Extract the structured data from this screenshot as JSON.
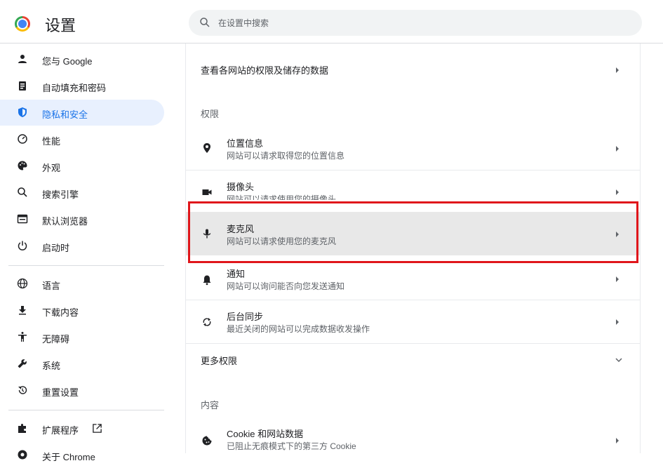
{
  "header": {
    "title": "设置",
    "search_placeholder": "在设置中搜索"
  },
  "sidebar": {
    "items": [
      {
        "label": "您与 Google",
        "icon": "person-icon"
      },
      {
        "label": "自动填充和密码",
        "icon": "clipboard-icon"
      },
      {
        "label": "隐私和安全",
        "icon": "shield-icon",
        "active": true
      },
      {
        "label": "性能",
        "icon": "speedometer-icon"
      },
      {
        "label": "外观",
        "icon": "palette-icon"
      },
      {
        "label": "搜索引擎",
        "icon": "search-icon"
      },
      {
        "label": "默认浏览器",
        "icon": "browser-icon"
      },
      {
        "label": "启动时",
        "icon": "power-icon"
      },
      {
        "label": "语言",
        "icon": "globe-icon"
      },
      {
        "label": "下载内容",
        "icon": "download-icon"
      },
      {
        "label": "无障碍",
        "icon": "accessibility-icon"
      },
      {
        "label": "系统",
        "icon": "wrench-icon"
      },
      {
        "label": "重置设置",
        "icon": "restore-icon"
      },
      {
        "label": "扩展程序",
        "icon": "puzzle-icon"
      },
      {
        "label": "关于 Chrome",
        "icon": "chrome-icon"
      }
    ]
  },
  "content": {
    "view_all_sites": "查看各网站的权限及储存的数据",
    "permissions_header": "权限",
    "permissions": [
      {
        "title": "位置信息",
        "subtitle": "网站可以请求取得您的位置信息",
        "icon": "location-pin-icon"
      },
      {
        "title": "摄像头",
        "subtitle": "网站可以请求使用您的摄像头",
        "icon": "camera-icon"
      },
      {
        "title": "麦克风",
        "subtitle": "网站可以请求使用您的麦克风",
        "icon": "microphone-icon"
      },
      {
        "title": "通知",
        "subtitle": "网站可以询问能否向您发送通知",
        "icon": "bell-icon"
      },
      {
        "title": "后台同步",
        "subtitle": "最近关闭的网站可以完成数据收发操作",
        "icon": "sync-icon"
      }
    ],
    "more_permissions": "更多权限",
    "content_header": "内容",
    "cookie_title": "Cookie 和网站数据",
    "cookie_subtitle": "已阻止无痕模式下的第三方 Cookie"
  },
  "colors": {
    "accent": "#1a73e8",
    "active_bg": "#e8f0fe",
    "highlight_border": "#e0161b"
  }
}
